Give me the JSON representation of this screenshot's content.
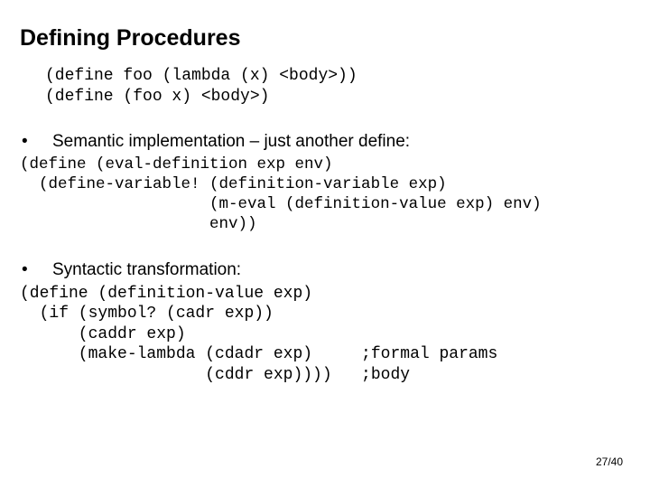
{
  "title": "Defining Procedures",
  "code1": "(define foo (lambda (x) <body>))\n(define (foo x) <body>)",
  "bullet1": "Semantic implementation – just another define:",
  "code2": "(define (eval-definition exp env)\n  (define-variable! (definition-variable exp)\n                    (m-eval (definition-value exp) env)\n                    env))",
  "bullet2": "Syntactic transformation:",
  "code3": "(define (definition-value exp)\n  (if (symbol? (cadr exp))\n      (caddr exp)\n      (make-lambda (cdadr exp)     ;formal params\n                   (cddr exp))))   ;body",
  "pagenum": "27/40"
}
